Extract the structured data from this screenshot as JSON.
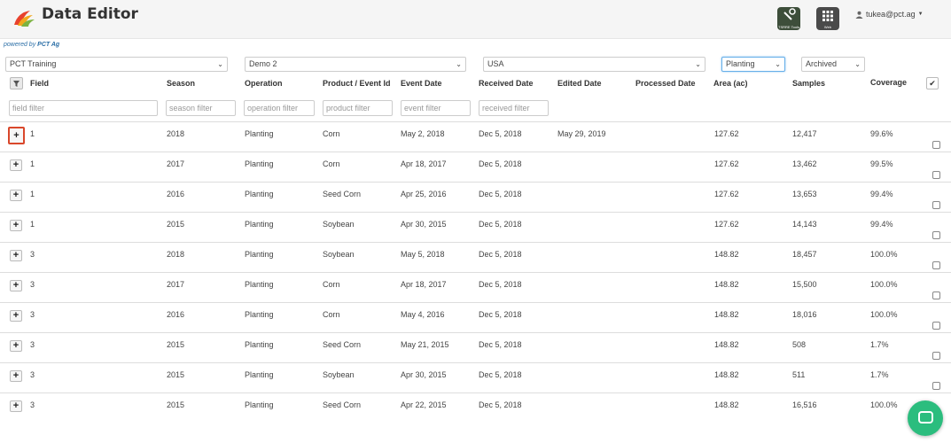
{
  "header": {
    "title": "Data Editor",
    "tsrre_caption": "TSRRE Tools",
    "apps_caption": "Web",
    "user": "tukea@pct.ag"
  },
  "powered": {
    "prefix": "powered by",
    "brand": "PCT Ag"
  },
  "filters": {
    "organization": "PCT Training",
    "farm": "Demo 2",
    "country": "USA",
    "operation": "Planting",
    "status": "Archived"
  },
  "columns": {
    "field": "Field",
    "season": "Season",
    "operation": "Operation",
    "product": "Product / Event Id",
    "event_date": "Event Date",
    "received_date": "Received Date",
    "edited_date": "Edited Date",
    "processed_date": "Processed Date",
    "area": "Area (ac)",
    "samples": "Samples",
    "coverage": "Coverage"
  },
  "column_filters": {
    "field": "field filter",
    "season": "season filter",
    "operation": "operation filter",
    "product": "product filter",
    "event": "event filter",
    "received": "received filter"
  },
  "rows": [
    {
      "field": "1",
      "season": "2018",
      "operation": "Planting",
      "product": "Corn",
      "event_date": "May 2, 2018",
      "received_date": "Dec 5, 2018",
      "edited_date": "May 29, 2019",
      "processed_date": "",
      "area": "127.62",
      "samples": "12,417",
      "coverage": "99.6%"
    },
    {
      "field": "1",
      "season": "2017",
      "operation": "Planting",
      "product": "Corn",
      "event_date": "Apr 18, 2017",
      "received_date": "Dec 5, 2018",
      "edited_date": "",
      "processed_date": "",
      "area": "127.62",
      "samples": "13,462",
      "coverage": "99.5%"
    },
    {
      "field": "1",
      "season": "2016",
      "operation": "Planting",
      "product": "Seed Corn",
      "event_date": "Apr 25, 2016",
      "received_date": "Dec 5, 2018",
      "edited_date": "",
      "processed_date": "",
      "area": "127.62",
      "samples": "13,653",
      "coverage": "99.4%"
    },
    {
      "field": "1",
      "season": "2015",
      "operation": "Planting",
      "product": "Soybean",
      "event_date": "Apr 30, 2015",
      "received_date": "Dec 5, 2018",
      "edited_date": "",
      "processed_date": "",
      "area": "127.62",
      "samples": "14,143",
      "coverage": "99.4%"
    },
    {
      "field": "3",
      "season": "2018",
      "operation": "Planting",
      "product": "Soybean",
      "event_date": "May 5, 2018",
      "received_date": "Dec 5, 2018",
      "edited_date": "",
      "processed_date": "",
      "area": "148.82",
      "samples": "18,457",
      "coverage": "100.0%"
    },
    {
      "field": "3",
      "season": "2017",
      "operation": "Planting",
      "product": "Corn",
      "event_date": "Apr 18, 2017",
      "received_date": "Dec 5, 2018",
      "edited_date": "",
      "processed_date": "",
      "area": "148.82",
      "samples": "15,500",
      "coverage": "100.0%"
    },
    {
      "field": "3",
      "season": "2016",
      "operation": "Planting",
      "product": "Corn",
      "event_date": "May 4, 2016",
      "received_date": "Dec 5, 2018",
      "edited_date": "",
      "processed_date": "",
      "area": "148.82",
      "samples": "18,016",
      "coverage": "100.0%"
    },
    {
      "field": "3",
      "season": "2015",
      "operation": "Planting",
      "product": "Seed Corn",
      "event_date": "May 21, 2015",
      "received_date": "Dec 5, 2018",
      "edited_date": "",
      "processed_date": "",
      "area": "148.82",
      "samples": "508",
      "coverage": "1.7%"
    },
    {
      "field": "3",
      "season": "2015",
      "operation": "Planting",
      "product": "Soybean",
      "event_date": "Apr 30, 2015",
      "received_date": "Dec 5, 2018",
      "edited_date": "",
      "processed_date": "",
      "area": "148.82",
      "samples": "511",
      "coverage": "1.7%"
    },
    {
      "field": "3",
      "season": "2015",
      "operation": "Planting",
      "product": "Seed Corn",
      "event_date": "Apr 22, 2015",
      "received_date": "Dec 5, 2018",
      "edited_date": "",
      "processed_date": "",
      "area": "148.82",
      "samples": "16,516",
      "coverage": "100.0%"
    }
  ],
  "icons": {
    "logo": "pct-logo-icon",
    "expand": "plus-icon",
    "filter": "funnel-icon",
    "check": "checkmark-icon",
    "chat": "chat-icon"
  },
  "colors": {
    "highlight": "#d9472b",
    "chat": "#2bbd7e",
    "brand_link": "#2a6ea6"
  }
}
